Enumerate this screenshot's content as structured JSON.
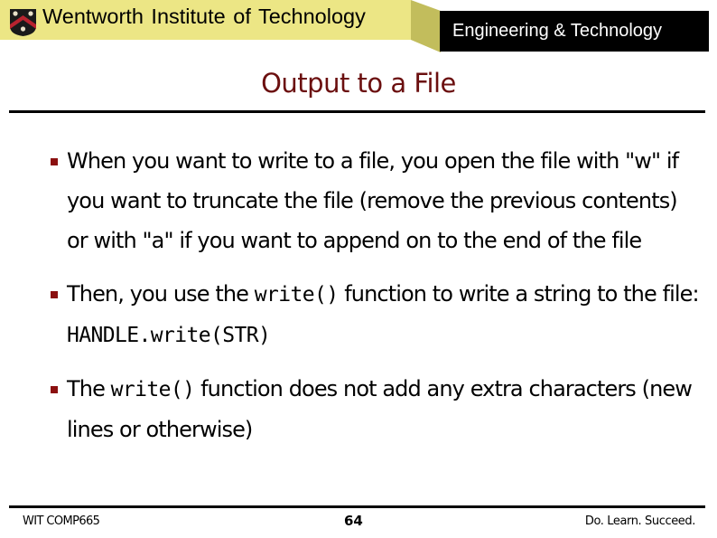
{
  "header": {
    "institution": "Wentworth Institute of Technology",
    "department": "Engineering & Technology",
    "logo_icon": "crest-shield-icon",
    "colors": {
      "banner": "#ece685",
      "bevel": "#c2bd5c",
      "department_box": "#000000",
      "crest_chevron": "#b8232f"
    }
  },
  "slide": {
    "title": "Output to a File",
    "title_color": "#6b0f0f",
    "bullet_color": "#8b1010",
    "bullets": [
      {
        "parts": [
          {
            "text": "When you want to write to a file, you open the file with \"w\" if you want to truncate the file (remove the previous contents) or with \"a\" if you want to append on to the end of the file",
            "code": false
          }
        ]
      },
      {
        "parts": [
          {
            "text": "Then, you use the ",
            "code": false
          },
          {
            "text": "write()",
            "code": true
          },
          {
            "text": "  function to write a string to the file: ",
            "code": false
          },
          {
            "text": "HANDLE.write(STR)",
            "code": true
          }
        ]
      },
      {
        "parts": [
          {
            "text": "The ",
            "code": false
          },
          {
            "text": "write()",
            "code": true
          },
          {
            "text": "  function does not add any extra characters (new lines or otherwise)",
            "code": false
          }
        ]
      }
    ]
  },
  "footer": {
    "course": "WIT COMP665",
    "page_number": "64",
    "slogan": "Do. Learn. Succeed."
  }
}
